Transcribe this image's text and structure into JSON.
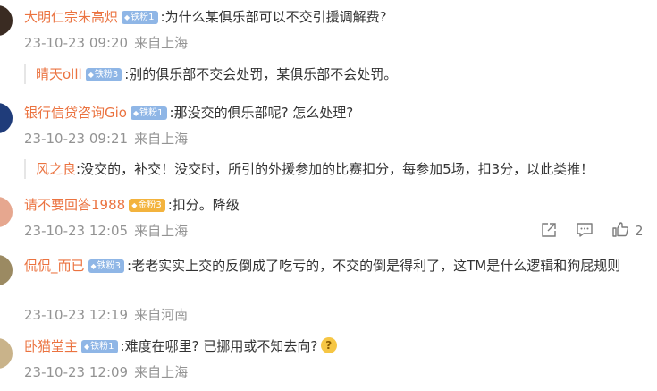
{
  "comments": [
    {
      "username": "大明仁宗朱高炽",
      "badge": "铁粉1",
      "text": ":为什么某俱乐部可以不交引援调解费?",
      "time": "23-10-23 09:20",
      "location": "来自上海",
      "reply": {
        "username": "晴天olll",
        "badge": "铁粉3",
        "text": ":别的俱乐部不交会处罚，某俱乐部不会处罚。"
      }
    },
    {
      "username": "银行信贷咨询Gio",
      "badge": "铁粉1",
      "text": ":那没交的俱乐部呢? 怎么处理?",
      "time": "23-10-23 09:21",
      "location": "来自上海",
      "reply": {
        "username": "风之良",
        "text": ":没交的，补交！没交时，所引的外援参加的比赛扣分，每参加5场，扣3分，以此类推！"
      }
    },
    {
      "username": "请不要回答1988",
      "badge": "金粉3",
      "text": ":扣分。降级",
      "time": "23-10-23 12:05",
      "location": "来自上海",
      "like_count": "2"
    },
    {
      "username": "侃侃_而已",
      "badge": "铁粉3",
      "text": ":老老实实上交的反倒成了吃亏的，不交的倒是得利了，这TM是什么逻辑和狗屁规则",
      "time": "23-10-23 12:19",
      "location": "来自河南"
    },
    {
      "username": "卧猫堂主",
      "badge": "铁粉1",
      "text": ":难度在哪里? 已挪用或不知去向?",
      "time": "23-10-23 12:09",
      "location": "来自上海"
    }
  ],
  "icons": {
    "share": "share-icon",
    "comment": "comment-icon",
    "like": "thumbs-up-icon",
    "emoji": "thinking-emoji-icon"
  },
  "colors": {
    "username": "#eb7340",
    "badge_iron": "#8fb6e6",
    "badge_gold": "#f3b33d",
    "meta": "#939393"
  }
}
